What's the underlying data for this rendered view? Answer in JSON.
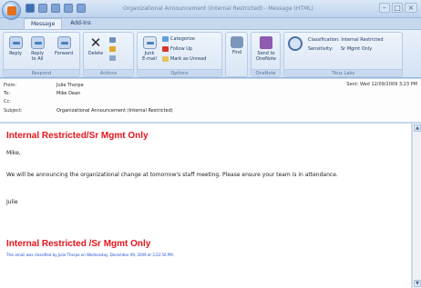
{
  "window": {
    "title": "Organizational Announcement (Internal Restricted) - Message (HTML)"
  },
  "tabs": [
    {
      "label": "Message",
      "active": true
    },
    {
      "label": "Add-Ins",
      "active": false
    }
  ],
  "ribbon": {
    "respond": {
      "label": "Respond",
      "reply": "Reply",
      "reply_all_1": "Reply",
      "reply_all_2": "to All",
      "forward": "Forward"
    },
    "actions": {
      "label": "Actions",
      "delete": "Delete"
    },
    "junk": {
      "line1": "Junk",
      "line2": "E-mail"
    },
    "options": {
      "label": "Options",
      "categorize": "Categorize",
      "follow_up": "Follow Up",
      "mark_unread": "Mark as Unread"
    },
    "find": {
      "label": "Find"
    },
    "onenote": {
      "label": "OneNote",
      "send_line1": "Send to",
      "send_line2": "OneNote"
    },
    "titus": {
      "label": "Titus Labs",
      "classification": "Classification: Internal Restricted",
      "sensitivity_label": "Sensitivity:",
      "sensitivity_value": "Sr Mgmt Only"
    }
  },
  "header": {
    "from_label": "From:",
    "from": "Julie Thorpe",
    "to_label": "To:",
    "to": "Mike Dean",
    "cc_label": "Cc:",
    "cc": "",
    "subject_label": "Subject:",
    "subject": "Organizational Announcement (Internal Restricted)",
    "sent": "Sent:  Wed 12/09/2009 3:23 PM"
  },
  "body": {
    "banner_top": "Internal Restricted/Sr Mgmt Only",
    "greeting": "Mike,",
    "paragraph": "We will be announcing the organizational change at tomorrow's staff meeting. Please ensure your team is in attendance.",
    "signature": "Julie",
    "banner_bottom": "Internal Restricted /Sr Mgmt Only",
    "classification_note": "This email was classified by Julie Thorpe on Wednesday, December 09, 2009 at 3:22:56 PM."
  },
  "colors": {
    "banner": "#e3141b",
    "note": "#1a4fcf",
    "ribbon": "#d3e2f4"
  }
}
